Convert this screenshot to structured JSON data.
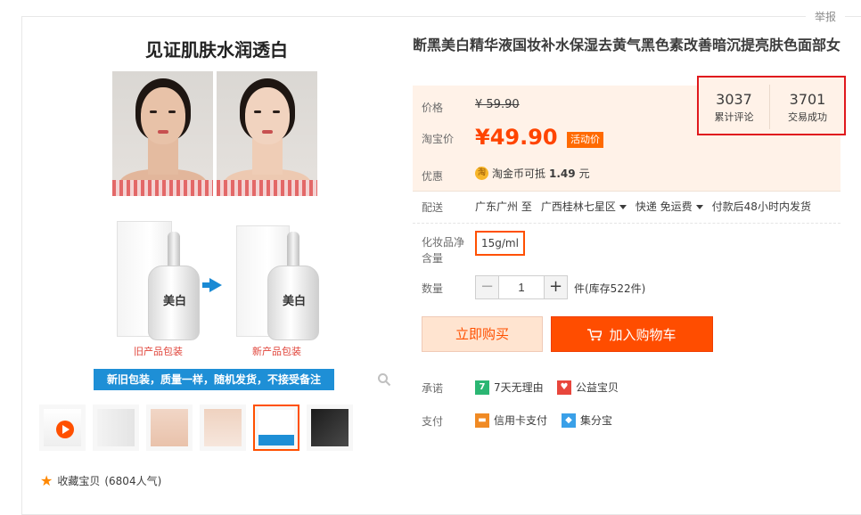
{
  "report_label": "举报",
  "gallery": {
    "hero_title": "见证肌肤水润透白",
    "old_bottle_label": "美白",
    "new_bottle_label": "美白",
    "caption_old": "旧产品包装",
    "caption_new": "新产品包装",
    "banner_text": "新旧包装，质量一样，随机发货，不接受备注",
    "thumbnail_count": 6,
    "active_thumbnail_index": 5
  },
  "favorite": {
    "label": "收藏宝贝",
    "count_text": "(6804人气)"
  },
  "product": {
    "title": "断黑美白精华液国妆补水保湿去黄气黑色素改善暗沉提亮肤色面部女"
  },
  "price": {
    "label": "价格",
    "original": "¥ 59.90",
    "taobao_label": "淘宝价",
    "sale": "¥49.90",
    "promo_tag": "活动价"
  },
  "stats": {
    "reviews_count": "3037",
    "reviews_label": "累计评论",
    "sales_count": "3701",
    "sales_label": "交易成功"
  },
  "discount": {
    "label": "优惠",
    "coin_icon_text": "淘",
    "text_prefix": "淘金币可抵",
    "amount": "1.49",
    "text_suffix": "元"
  },
  "shipping": {
    "label": "配送",
    "origin": "广东广州 至",
    "destination": "广西桂林七星区",
    "method": "快递 免运费",
    "dispatch": "付款后48小时内发货"
  },
  "spec": {
    "label": "化妆品净含量",
    "selected": "15g/ml"
  },
  "quantity": {
    "label": "数量",
    "value": "1",
    "minus": "−",
    "plus": "+",
    "stock": "件(库存522件)"
  },
  "actions": {
    "buy_now": "立即购买",
    "add_to_cart": "加入购物车"
  },
  "promise": {
    "label": "承诺",
    "items": [
      {
        "icon_text": "7",
        "text": "7天无理由",
        "color": "#2bb673"
      },
      {
        "icon_text": "♥",
        "text": "公益宝贝",
        "color": "#e8463c"
      }
    ]
  },
  "payment": {
    "label": "支付",
    "items": [
      {
        "icon_text": "▬",
        "text": "信用卡支付",
        "color": "#f08a24"
      },
      {
        "icon_text": "◆",
        "text": "集分宝",
        "color": "#3aa0e8"
      }
    ]
  },
  "colors": {
    "accent": "#ff5000",
    "price": "#ff4400",
    "highlight_box": "#e0191d",
    "banner": "#1e8fd6"
  }
}
